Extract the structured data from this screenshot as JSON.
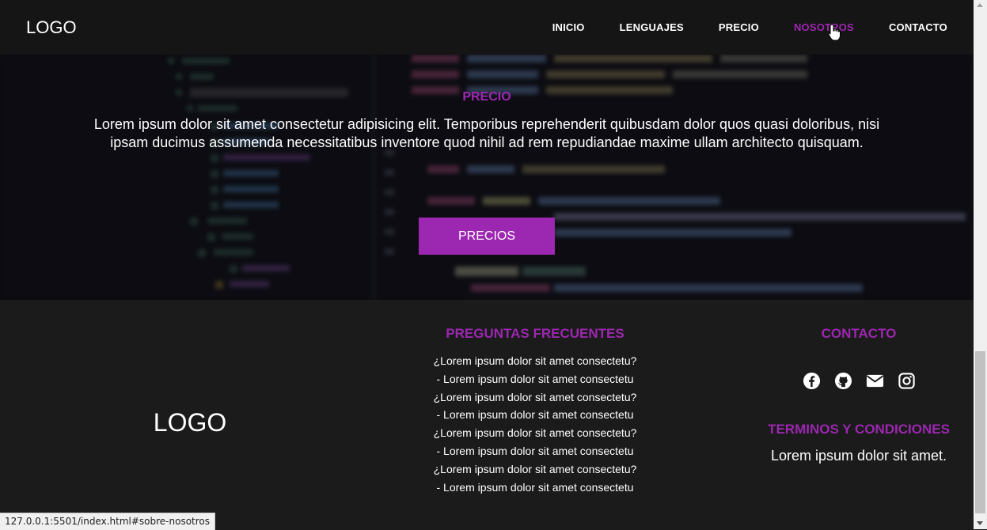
{
  "nav": {
    "logo": "LOGO",
    "links": [
      {
        "label": "INICIO",
        "active": false
      },
      {
        "label": "LENGUAJES",
        "active": false
      },
      {
        "label": "PRECIO",
        "active": false
      },
      {
        "label": "NOSOTROS",
        "active": true
      },
      {
        "label": "CONTACTO",
        "active": false
      }
    ]
  },
  "hero": {
    "title": "PRECIO",
    "text": "Lorem ipsum dolor sit amet consectetur adipisicing elit. Temporibus reprehenderit quibusdam dolor quos quasi doloribus, nisi ipsam ducimus assumenda necessitatibus inventore quod nihil ad rem repudiandae maxime ullam architecto quisquam.",
    "button": "PRECIOS"
  },
  "footer": {
    "logo": "LOGO",
    "faq": {
      "title": "PREGUNTAS FRECUENTES",
      "lines": [
        "¿Lorem ipsum dolor sit amet consectetu?",
        "- Lorem ipsum dolor sit amet consectetu",
        "¿Lorem ipsum dolor sit amet consectetu?",
        "- Lorem ipsum dolor sit amet consectetu",
        "¿Lorem ipsum dolor sit amet consectetu?",
        "- Lorem ipsum dolor sit amet consectetu",
        "¿Lorem ipsum dolor sit amet consectetu?",
        "- Lorem ipsum dolor sit amet consectetu"
      ]
    },
    "contact": {
      "title": "CONTACTO",
      "icons": [
        "facebook-icon",
        "github-icon",
        "mail-icon",
        "instagram-icon"
      ]
    },
    "terms": {
      "title": "TERMINOS Y CONDICIONES",
      "text": "Lorem ipsum dolor sit amet."
    }
  },
  "status_bar": {
    "url": "127.0.0.1:5501/index.html#sobre-nosotros"
  },
  "colors": {
    "accent": "#9c27b0",
    "background": "#1b1b1b",
    "navbar": "#151515"
  }
}
